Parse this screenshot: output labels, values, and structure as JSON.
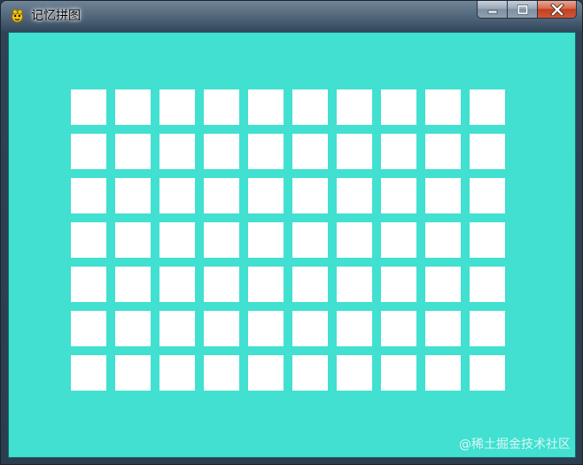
{
  "window": {
    "title": "记忆拼图",
    "app_icon": "pygame-snake-icon",
    "controls": {
      "minimize_icon": "minimize-icon",
      "maximize_icon": "maximize-icon",
      "close_icon": "close-icon"
    }
  },
  "board": {
    "background_color": "#41e0d0",
    "card_color": "#ffffff",
    "columns": 10,
    "rows": 7,
    "cards_face_down": 70
  },
  "watermark": "@稀土掘金技术社区"
}
